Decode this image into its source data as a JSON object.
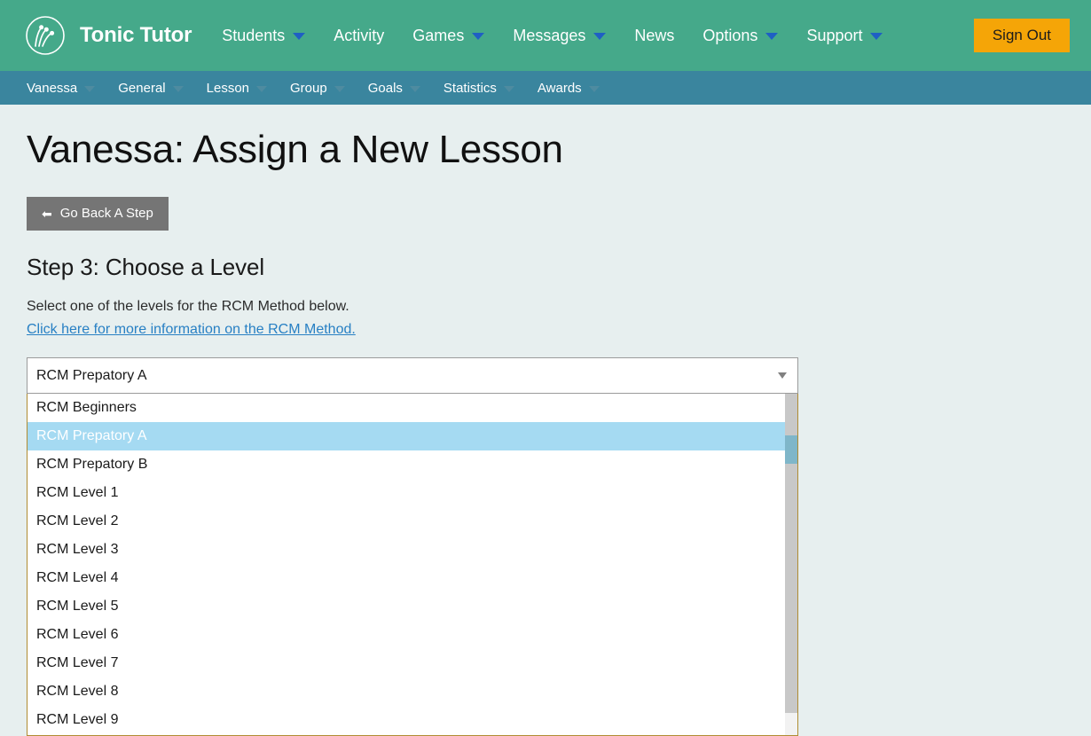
{
  "header": {
    "logo_icon": "tonic-tutor-logo-icon",
    "brand": "Tonic Tutor",
    "nav": [
      {
        "label": "Students",
        "has_caret": true
      },
      {
        "label": "Activity",
        "has_caret": false
      },
      {
        "label": "Games",
        "has_caret": true
      },
      {
        "label": "Messages",
        "has_caret": true
      },
      {
        "label": "News",
        "has_caret": false
      },
      {
        "label": "Options",
        "has_caret": true
      },
      {
        "label": "Support",
        "has_caret": true
      }
    ],
    "sign_out_label": "Sign Out",
    "bg_color": "#45a98a",
    "sign_out_color": "#f5a507"
  },
  "subnav": {
    "bg_color": "#3a859e",
    "items": [
      {
        "label": "Vanessa",
        "has_caret": true
      },
      {
        "label": "General",
        "has_caret": true
      },
      {
        "label": "Lesson",
        "has_caret": true
      },
      {
        "label": "Group",
        "has_caret": true
      },
      {
        "label": "Goals",
        "has_caret": true
      },
      {
        "label": "Statistics",
        "has_caret": true
      },
      {
        "label": "Awards",
        "has_caret": true
      }
    ]
  },
  "main": {
    "page_title": "Vanessa: Assign a New Lesson",
    "go_back_label": "Go Back A Step",
    "go_back_icon": "arrow-left-icon",
    "step_heading": "Step 3: Choose a Level",
    "step_description": "Select one of the levels for the RCM Method below.",
    "info_link_label": "Click here for more information on the RCM Method.",
    "link_color": "#2880c4"
  },
  "level_select": {
    "selected_value": "RCM Prepatory A",
    "expanded": true,
    "caret_icon": "chevron-down-icon",
    "highlight_color": "#a5daf2",
    "border_color": "#b08c32",
    "options": [
      "RCM Beginners",
      "RCM Prepatory A",
      "RCM Prepatory B",
      "RCM Level 1",
      "RCM Level 2",
      "RCM Level 3",
      "RCM Level 4",
      "RCM Level 5",
      "RCM Level 6",
      "RCM Level 7",
      "RCM Level 8",
      "RCM Level 9"
    ]
  }
}
